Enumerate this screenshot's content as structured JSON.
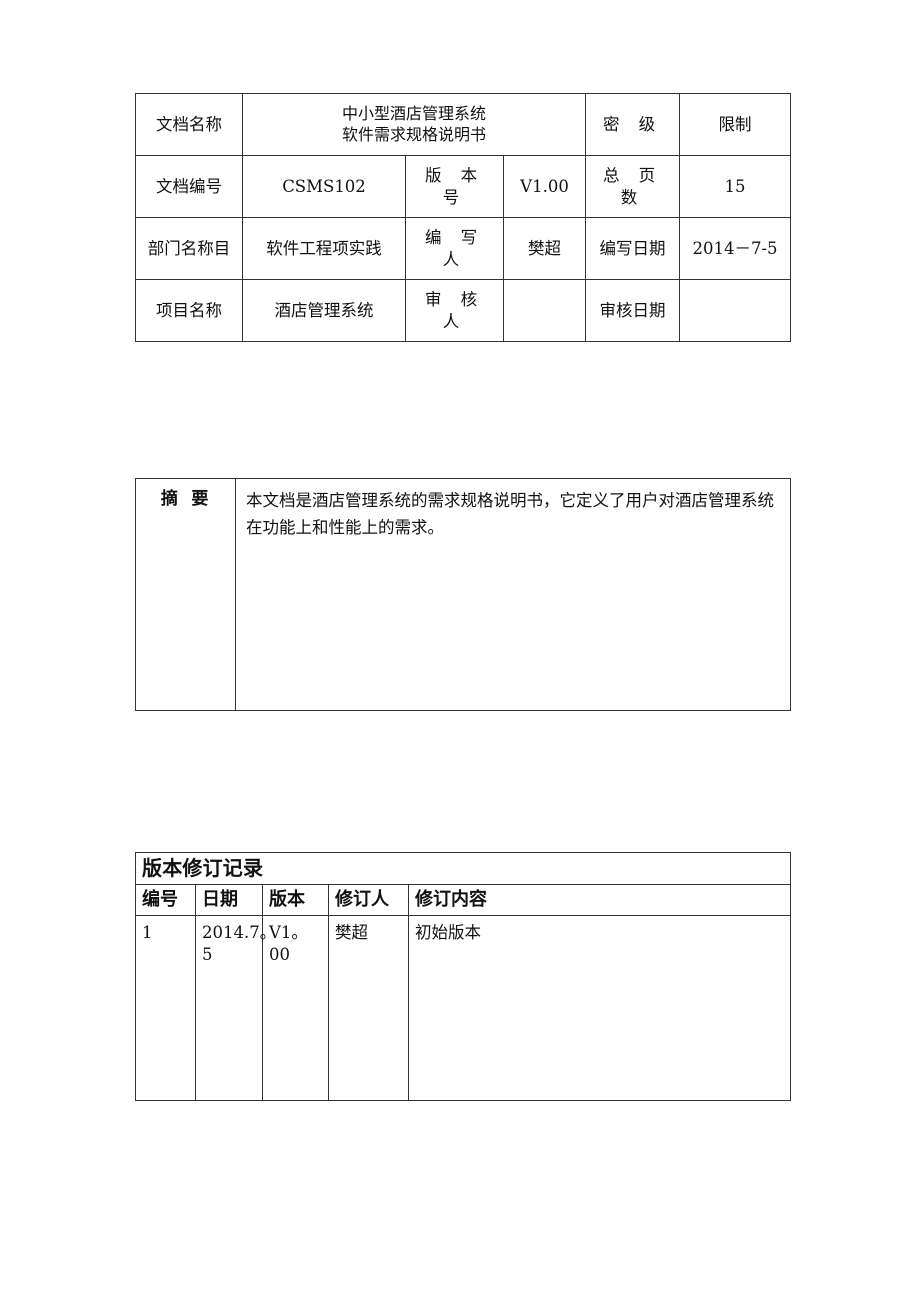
{
  "document": {
    "meta_table": {
      "rows": [
        {
          "label": "文档名称",
          "title_line1": "中小型酒店管理系统",
          "title_line2": "软件需求规格说明书",
          "security_label": "密 级",
          "security_value": "限制"
        },
        {
          "label": "文档编号",
          "value": "CSMS102",
          "version_label": "版 本 号",
          "version_value": "V1.00",
          "pages_label": "总 页 数",
          "pages_value": "15"
        },
        {
          "label": "部门名称目",
          "value": "软件工程项实践",
          "author_label": "编 写 人",
          "author_value": "樊超",
          "date_label": "编写日期",
          "date_value": "2014－7-5"
        },
        {
          "label": "项目名称",
          "value": "酒店管理系统",
          "reviewer_label": "审 核 人",
          "reviewer_value": "",
          "review_date_label": "审核日期",
          "review_date_value": ""
        }
      ]
    },
    "abstract": {
      "label": "摘 要",
      "text": "本文档是酒店管理系统的需求规格说明书，它定义了用户对酒店管理系统在功能上和性能上的需求。"
    },
    "revision": {
      "title": "版本修订记录",
      "headers": [
        "编号",
        "日期",
        "版本",
        "修订人",
        "修订内容"
      ],
      "rows": [
        {
          "no": "1",
          "date": "2014.7。5",
          "version": "V1。00",
          "reviser": "樊超",
          "content": "初始版本"
        }
      ]
    }
  }
}
